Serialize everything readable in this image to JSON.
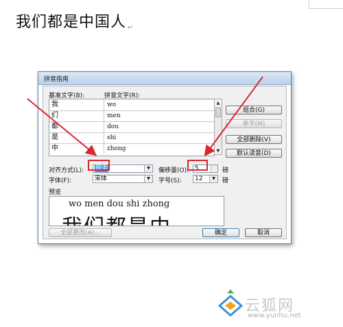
{
  "document": {
    "text": "我们都是中国人",
    "paragraph_mark": "↵"
  },
  "dialog": {
    "title": "拼音指南",
    "base_header": "基准文字(B):",
    "pinyin_header": "拼音文字(R):",
    "rows": [
      {
        "base": "我",
        "pinyin": "wo"
      },
      {
        "base": "们",
        "pinyin": "men"
      },
      {
        "base": "都",
        "pinyin": "dou"
      },
      {
        "base": "是",
        "pinyin": "shi"
      },
      {
        "base": "中",
        "pinyin": "zhong"
      }
    ],
    "buttons": {
      "combine": "组合(G)",
      "single": "单字(M)",
      "clear_all": "全部删除(V)",
      "default_reading": "默认读音(D)",
      "change_all": "全部更改(A)...",
      "ok": "确定",
      "cancel": "取消"
    },
    "alignment_label": "对齐方式(L):",
    "alignment_value": "居中",
    "offset_label": "偏移量(O):",
    "offset_value": "5",
    "offset_unit": "磅",
    "font_label": "字体(F):",
    "font_value": "宋体",
    "size_label": "字号(S):",
    "size_value": "12",
    "size_unit": "磅",
    "preview_label": "预览",
    "preview_pinyin": "wo  men dou shi zhong",
    "preview_chars": "我们都是中"
  },
  "watermark": {
    "text": "云狐网",
    "url": "www.yunhu.net"
  },
  "colors": {
    "highlight": "#d9272e",
    "selection": "#3399ff"
  }
}
